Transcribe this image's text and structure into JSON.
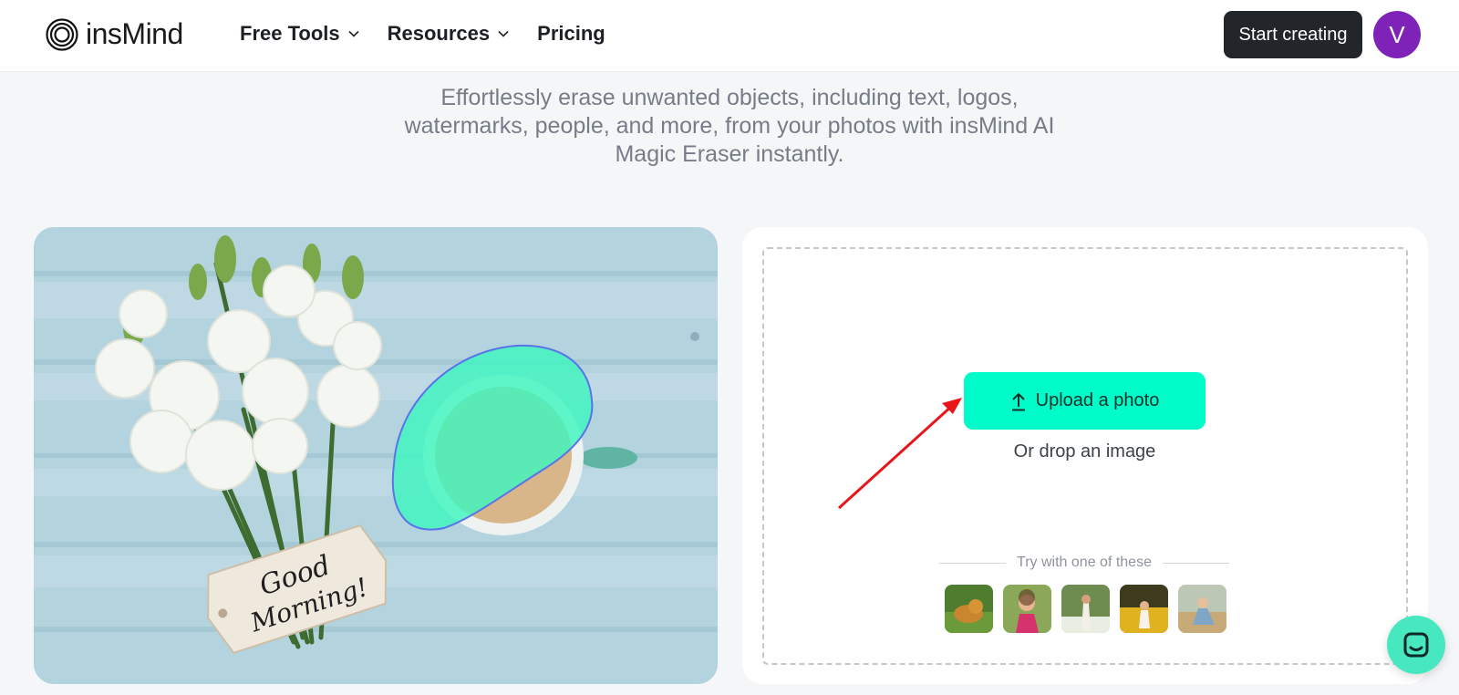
{
  "header": {
    "logo_text": "insMind",
    "nav": [
      {
        "label": "Free Tools",
        "has_dropdown": true
      },
      {
        "label": "Resources",
        "has_dropdown": true
      },
      {
        "label": "Pricing",
        "has_dropdown": false
      }
    ],
    "start_button": "Start creating",
    "avatar_initial": "V"
  },
  "hero": {
    "subtitle": "Effortlessly erase unwanted objects, including text, logos, watermarks, people, and more, from your photos with insMind AI Magic Eraser instantly.",
    "card_text_line1": "Good",
    "card_text_line2": "Morning!"
  },
  "upload": {
    "button_label": "Upload a photo",
    "drop_text": "Or drop an image",
    "try_label": "Try with one of these",
    "samples": [
      "dog-sample-icon",
      "girl-sample-icon",
      "woman-field-sample-icon",
      "child-flowers-sample-icon",
      "person-sitting-sample-icon"
    ]
  },
  "colors": {
    "accent": "#00fcc8",
    "start_button_bg": "#22262b",
    "avatar_bg": "#7e22b8",
    "arrow": "#e8161b"
  }
}
